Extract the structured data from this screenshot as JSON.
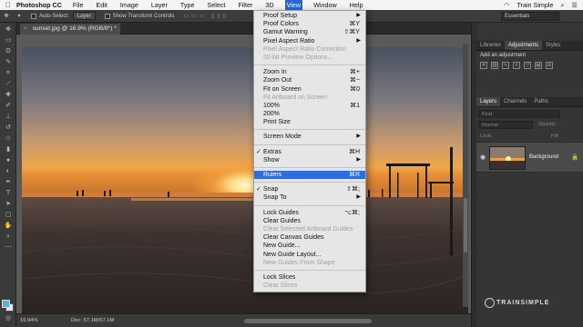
{
  "menubar": {
    "app_name": "Photoshop CC",
    "items": [
      "File",
      "Edit",
      "Image",
      "Layer",
      "Type",
      "Select",
      "Filter",
      "3D",
      "View",
      "Window",
      "Help"
    ],
    "active_item": "View",
    "user_name": "Train Simple"
  },
  "options_bar": {
    "auto_select_label": "Auto-Select:",
    "auto_select_value": "Layer",
    "transform_label": "Show Transform Controls",
    "workspace": "Essentials"
  },
  "document": {
    "tab_title": "sunset.jpg @ 16.9% (RGB/8*) *",
    "zoom": "16.94%",
    "doc_size": "Doc: 57.1M/57.1M"
  },
  "panels": {
    "top_tabs": [
      "Libraries",
      "Adjustments",
      "Styles"
    ],
    "active_top_tab": "Adjustments",
    "add_adjustment_label": "Add an adjustment",
    "layer_tabs": [
      "Layers",
      "Channels",
      "Paths"
    ],
    "active_layer_tab": "Layers",
    "kind_label": "Kind",
    "blend_mode": "Normal",
    "opacity_label": "Opacity:",
    "lock_label": "Lock:",
    "fill_label": "Fill:",
    "layer_name": "Background"
  },
  "watermark": "TRAINSIMPLE",
  "view_menu": {
    "items": [
      {
        "label": "Proof Setup",
        "shortcut": "",
        "submenu": true,
        "enabled": true
      },
      {
        "label": "Proof Colors",
        "shortcut": "⌘Y",
        "enabled": true
      },
      {
        "label": "Gamut Warning",
        "shortcut": "⇧⌘Y",
        "enabled": true
      },
      {
        "label": "Pixel Aspect Ratio",
        "shortcut": "",
        "submenu": true,
        "enabled": true
      },
      {
        "label": "Pixel Aspect Ratio Correction",
        "shortcut": "",
        "enabled": false
      },
      {
        "label": "32-bit Preview Options...",
        "shortcut": "",
        "enabled": false
      },
      {
        "separator": true
      },
      {
        "label": "Zoom In",
        "shortcut": "⌘+",
        "enabled": true
      },
      {
        "label": "Zoom Out",
        "shortcut": "⌘−",
        "enabled": true
      },
      {
        "label": "Fit on Screen",
        "shortcut": "⌘0",
        "enabled": true
      },
      {
        "label": "Fit Artboard on Screen",
        "shortcut": "",
        "enabled": false
      },
      {
        "label": "100%",
        "shortcut": "⌘1",
        "enabled": true
      },
      {
        "label": "200%",
        "shortcut": "",
        "enabled": true
      },
      {
        "label": "Print Size",
        "shortcut": "",
        "enabled": true
      },
      {
        "separator": true
      },
      {
        "label": "Screen Mode",
        "shortcut": "",
        "submenu": true,
        "enabled": true
      },
      {
        "separator": true
      },
      {
        "label": "Extras",
        "shortcut": "⌘H",
        "checked": true,
        "enabled": true
      },
      {
        "label": "Show",
        "shortcut": "",
        "submenu": true,
        "enabled": true
      },
      {
        "separator": true
      },
      {
        "label": "Rulers",
        "shortcut": "⌘R",
        "enabled": true,
        "highlighted": true
      },
      {
        "separator": true
      },
      {
        "label": "Snap",
        "shortcut": "⇧⌘;",
        "checked": true,
        "enabled": true
      },
      {
        "label": "Snap To",
        "shortcut": "",
        "submenu": true,
        "enabled": true
      },
      {
        "separator": true
      },
      {
        "label": "Lock Guides",
        "shortcut": "⌥⌘;",
        "enabled": true
      },
      {
        "label": "Clear Guides",
        "shortcut": "",
        "enabled": true
      },
      {
        "label": "Clear Selected Artboard Guides",
        "shortcut": "",
        "enabled": false
      },
      {
        "label": "Clear Canvas Guides",
        "shortcut": "",
        "enabled": true
      },
      {
        "label": "New Guide...",
        "shortcut": "",
        "enabled": true
      },
      {
        "label": "New Guide Layout...",
        "shortcut": "",
        "enabled": true
      },
      {
        "label": "New Guides From Shape",
        "shortcut": "",
        "enabled": false
      },
      {
        "separator": true
      },
      {
        "label": "Lock Slices",
        "shortcut": "",
        "enabled": true
      },
      {
        "label": "Clear Slices",
        "shortcut": "",
        "enabled": false
      }
    ]
  }
}
